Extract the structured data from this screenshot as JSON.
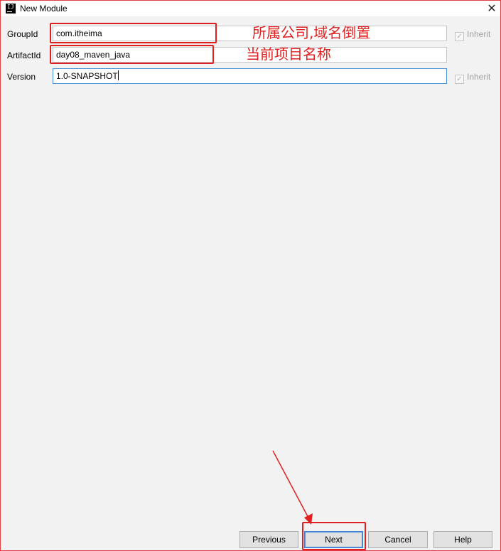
{
  "window": {
    "title": "New Module",
    "app_icon_text": "IJ",
    "close_glyph": "✕"
  },
  "form": {
    "group_id": {
      "label": "GroupId",
      "value": "com.itheima",
      "inherit_label": "Inherit",
      "inherit_checked": true
    },
    "artifact_id": {
      "label": "ArtifactId",
      "value": "day08_maven_java"
    },
    "version": {
      "label": "Version",
      "value": "1.0-SNAPSHOT",
      "inherit_label": "Inherit",
      "inherit_checked": true
    }
  },
  "annotations": {
    "group_note": "所属公司,域名倒置",
    "artifact_note": "当前项目名称",
    "color": "#e02020"
  },
  "buttons": {
    "previous": "Previous",
    "next": "Next",
    "cancel": "Cancel",
    "help": "Help"
  },
  "colors": {
    "accent": "#4a8fd8",
    "background": "#f2f2f2",
    "annotation_red": "#e02020"
  }
}
